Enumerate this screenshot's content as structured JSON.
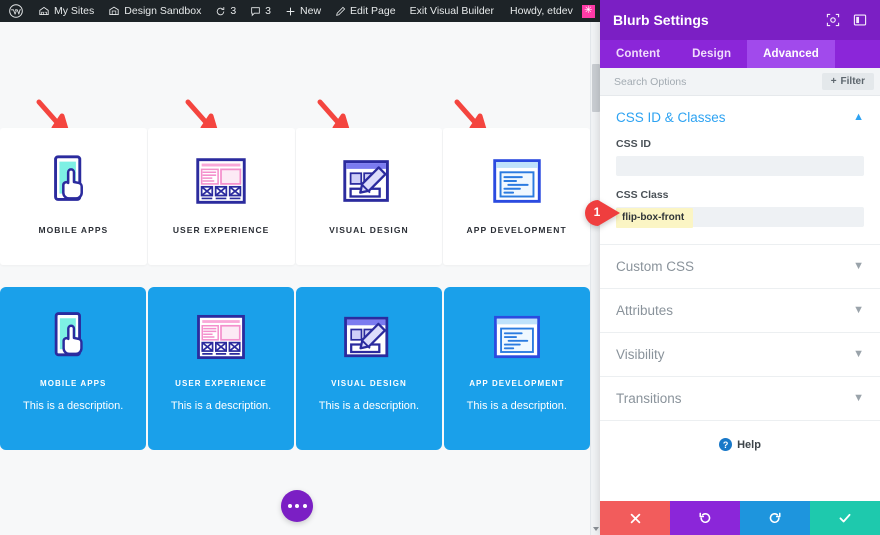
{
  "adminbar": {
    "items": [
      {
        "icon": "wordpress-logo-icon",
        "label": ""
      },
      {
        "icon": "sites-icon",
        "label": "My Sites"
      },
      {
        "icon": "site-icon",
        "label": "Design Sandbox"
      },
      {
        "icon": "updates-icon",
        "label": "3"
      },
      {
        "icon": "comments-icon",
        "label": "3"
      },
      {
        "icon": "plus-icon",
        "label": "New"
      },
      {
        "icon": "pencil-icon",
        "label": "Edit Page"
      },
      {
        "icon": "",
        "label": "Exit Visual Builder"
      }
    ],
    "greeting": "Howdy, etdev",
    "avatar_glyph": "✳",
    "search_icon": "search-icon"
  },
  "canvas": {
    "cards_top": [
      {
        "title": "MOBILE APPS",
        "icon": "mobile-touch-icon"
      },
      {
        "title": "USER EXPERIENCE",
        "icon": "wireframe-icon"
      },
      {
        "title": "VISUAL DESIGN",
        "icon": "design-pencil-icon"
      },
      {
        "title": "APP DEVELOPMENT",
        "icon": "code-window-icon"
      }
    ],
    "cards_bottom": [
      {
        "title": "MOBILE APPS",
        "description": "This is a description.",
        "icon": "mobile-touch-icon"
      },
      {
        "title": "USER EXPERIENCE",
        "description": "This is a description.",
        "icon": "wireframe-icon"
      },
      {
        "title": "VISUAL DESIGN",
        "description": "This is a description.",
        "icon": "design-pencil-icon"
      },
      {
        "title": "APP DEVELOPMENT",
        "description": "This is a description.",
        "icon": "code-window-icon"
      }
    ],
    "blue_bg": "#1aa0ea",
    "arrow_color": "#f4453f",
    "fab_color": "#7b1fc4"
  },
  "panel": {
    "title": "Blurb Settings",
    "head_icons": [
      "focus-target-icon",
      "panel-layout-icon"
    ],
    "accent": "#7b1fc4",
    "tabs": [
      {
        "label": "Content",
        "active": false
      },
      {
        "label": "Design",
        "active": false
      },
      {
        "label": "Advanced",
        "active": true
      }
    ],
    "search": {
      "placeholder": "Search Options",
      "value": ""
    },
    "filter_label": "Filter",
    "open_section": {
      "title": "CSS ID & Classes",
      "fields": [
        {
          "label": "CSS ID",
          "value": "",
          "highlighted": false
        },
        {
          "label": "CSS Class",
          "value": "flip-box-front",
          "highlighted": true
        }
      ]
    },
    "collapsed_sections": [
      {
        "title": "Custom CSS"
      },
      {
        "title": "Attributes"
      },
      {
        "title": "Visibility"
      },
      {
        "title": "Transitions"
      }
    ],
    "help_label": "Help",
    "footer": [
      {
        "name": "close",
        "icon": "x-icon",
        "color": "#f25c5c"
      },
      {
        "name": "undo",
        "icon": "undo-icon",
        "color": "#8b26d9"
      },
      {
        "name": "redo",
        "icon": "redo-icon",
        "color": "#1e95dd"
      },
      {
        "name": "save",
        "icon": "check-icon",
        "color": "#1ec9ad"
      }
    ]
  },
  "marker": {
    "number": "1",
    "color": "#ef3e3e"
  }
}
